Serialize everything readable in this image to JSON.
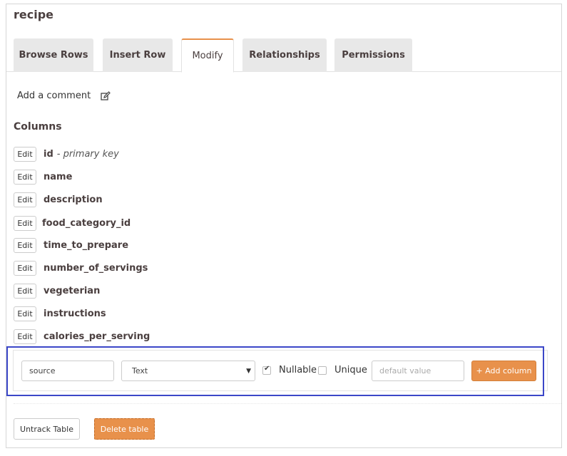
{
  "table_name": "recipe",
  "tabs": [
    {
      "label": "Browse Rows",
      "active": false
    },
    {
      "label": "Insert Row",
      "active": false
    },
    {
      "label": "Modify",
      "active": true
    },
    {
      "label": "Relationships",
      "active": false
    },
    {
      "label": "Permissions",
      "active": false
    }
  ],
  "comment": {
    "label": "Add a comment",
    "icon": "edit-icon"
  },
  "columns_section": {
    "title": "Columns",
    "edit_label": "Edit"
  },
  "columns": [
    {
      "name": "id",
      "note": "- primary key"
    },
    {
      "name": "name",
      "note": ""
    },
    {
      "name": "description",
      "note": ""
    },
    {
      "name": "food_category_id",
      "note": ""
    },
    {
      "name": "time_to_prepare",
      "note": ""
    },
    {
      "name": "number_of_servings",
      "note": ""
    },
    {
      "name": "vegeterian",
      "note": ""
    },
    {
      "name": "instructions",
      "note": ""
    },
    {
      "name": "calories_per_serving",
      "note": ""
    }
  ],
  "add_column": {
    "name_value": "source",
    "type_value": "Text",
    "nullable_label": "Nullable",
    "nullable_checked": true,
    "unique_label": "Unique",
    "unique_checked": false,
    "default_placeholder": "default value",
    "button_label": "+ Add column"
  },
  "footer": {
    "untrack_label": "Untrack Table",
    "delete_label": "Delete table"
  },
  "colors": {
    "accent": "#e8914b",
    "highlight_border": "#3b47c8"
  }
}
